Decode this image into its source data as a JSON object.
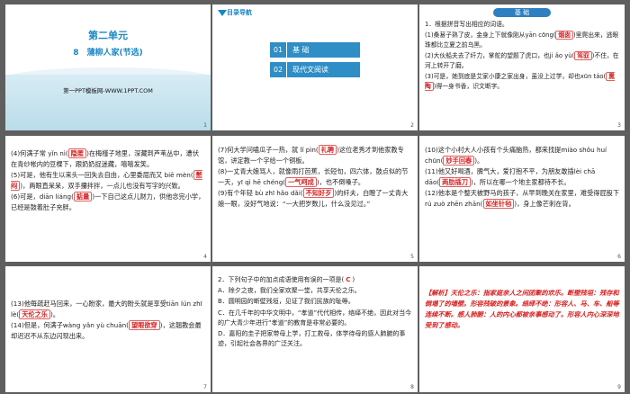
{
  "slide1": {
    "unit": "第二单元",
    "lesson": "8　蒲柳人家(节选)",
    "site": "第一PPT模板网-WWW.1PPT.COM",
    "num": "1"
  },
  "slide2": {
    "head": "目录导航",
    "items": [
      {
        "n": "01",
        "label": "基 础"
      },
      {
        "n": "02",
        "label": "现代文阅读"
      }
    ],
    "num": "2"
  },
  "slide3": {
    "badge": "基 础",
    "q1": "1．根据拼音写出相应的词语。",
    "l1a": "(1)桑葚子熟了皮，金身上下就像刚从yān cōng(",
    "a1": "烟囱",
    "l1b": ")里爬出来，逃眼珠都比立夏之前乌黑。",
    "l2a": "(2)大伙船夫去了纤力，掌舵的望题了虎口，也ji ǎo yù(",
    "a2": "驾驭",
    "l2b": ")不住，在河上转开了磨。",
    "l3a": "(3)可是，她到底是艾家小康之家出身，虽没上过学，却也xūn táo(",
    "a3": "熏陶",
    "l3b": ")得一身书香，识文断字。",
    "num": "3"
  },
  "slide4": {
    "l1a": "(4)何满子常 yǐn nì(",
    "a1": "隐匿",
    "l1b": ")在梅槿子地里，深藏到芦苇丛中，遭伏在青纱帐内的豆棵下，跟奶奶捉迷藏，嘻嘻发笑。",
    "l2a": "(5)可是，他有生以来头一回失去自由，心里委屈而又 biē mèn(",
    "a2": "憋闷",
    "l2b": ")，两眼直呆呆，双手攥拌拌，一点儿也没有写字的兴致。",
    "l3a": "(6)可是，diān liáng(",
    "a3": "掂量",
    "l3b": ")一下自己这点儿财力，供他念完小学，已经是鼓着肚子充胖。",
    "num": "4"
  },
  "slide5": {
    "l1a": "(7)何大学问嗑瓜子一热，就 lǐ pìn(",
    "a1": "礼聘",
    "l1b": ")这位老秀才到他家教专馆，讲定教一个字给一个铜板。",
    "l2a": "(8)一丈青大娘骂人，就像雨打芭蕉，长短句，四六体，鼓点似的节一天，yī qì hē chéng(",
    "a2": "一气呵成",
    "l2b": ")，也不倒嗓子。",
    "l3a": "(9)有个年轻 bù zhī hǎo dǎi(",
    "a3": "不知好歹",
    "l3b": ")的纤夫，白瞪了一丈青大娘一眼，没好气地说：“一大把岁数儿，什么没见过。”",
    "num": "5"
  },
  "slide6": {
    "l1a": "(10)这个小村大人小孩有个头痛脑热，都来找提miào shǒu huí chūn(",
    "a1": "妙手回春",
    "l1b": ")。",
    "l2a": "(11)他又好喝酒，脾气大，爱打抱不平，为朋友敢插lèi chā dāo(",
    "a2": "两肋插刀",
    "l2b": ")，所以在哪一个地主家都待不长。",
    "l3a": "(12)他本是个整天被野马的孩子，从早到晚关在家里，难受得屁股下rú zuò zhēn zhān(",
    "a3": "如坐针毡",
    "l3b": ")，身上像芒刺在背。",
    "num": "6"
  },
  "slide7": {
    "l1a": "(13)他每疏赶马回来，一心盼家，最大的盼头就是享受tiān lún zhī lè(",
    "a1": "天伦之乐",
    "l1b": ")。",
    "l2a": "(14)但是，何满子wàng yǎn yù chuān(",
    "a2": "望眼欲穿",
    "l2b": ")，这翘教会最却迟迟不从东边闪现出来。",
    "num": "7"
  },
  "slide8": {
    "q": "2．下列句子中的加点成语使用有误的一项是(",
    "ans": "C",
    "qend": ")",
    "A": "A．除夕之夜，我们全家欢聚一堂，共享天伦之乐。",
    "B": "B．圆明园的断壁残垣，见证了我们民族的耻辱。",
    "C": "C．在几千年的中华文明中，“孝道”代代相传，络绎不绝，因此对当今的广大青少年进行“孝道”的教育是非常必要的。",
    "D": "D．嘉阳的圭子把家带母上学，打工救母，体学待母的感人肺腑的事迹，引起社会各界的广泛关注。",
    "num": "8"
  },
  "slide9": {
    "tag": "【解析】",
    "text": "天伦之乐：指家庭亲人之间团聚的欢乐。断壁残垣：残存和倒塌了的墙壁。形容残破的景象。络绎不绝：形容人、马、车、船等连续不断。感人肺腑：人的内心都被亲事感动了。形容人内心深深地受到了感动。",
    "num": "9"
  }
}
